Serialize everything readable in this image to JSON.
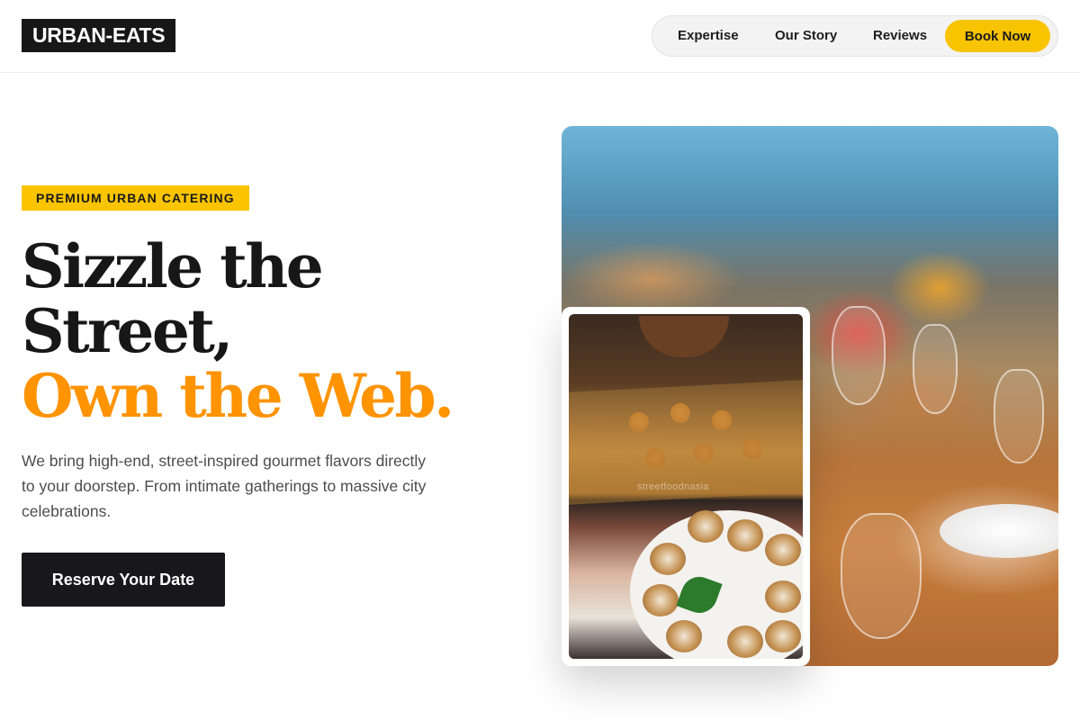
{
  "header": {
    "logo": "URBAN-EATS",
    "nav": [
      {
        "label": "Expertise"
      },
      {
        "label": "Our Story"
      },
      {
        "label": "Reviews"
      }
    ],
    "cta_label": "Book Now"
  },
  "hero": {
    "badge": "PREMIUM URBAN CATERING",
    "headline_line1": "Sizzle the",
    "headline_line2": "Street,",
    "headline_line3": "Own the Web.",
    "description": "We bring high-end, street-inspired gourmet flavors directly to your doorstep. From intimate gatherings to massive city celebrations.",
    "cta_label": "Reserve Your Date",
    "food_watermark": "streetfoodnasia"
  },
  "colors": {
    "accent_yellow": "#f8c300",
    "accent_orange": "#ff9300",
    "dark": "#18181b",
    "text_muted": "#4d4d4d"
  }
}
